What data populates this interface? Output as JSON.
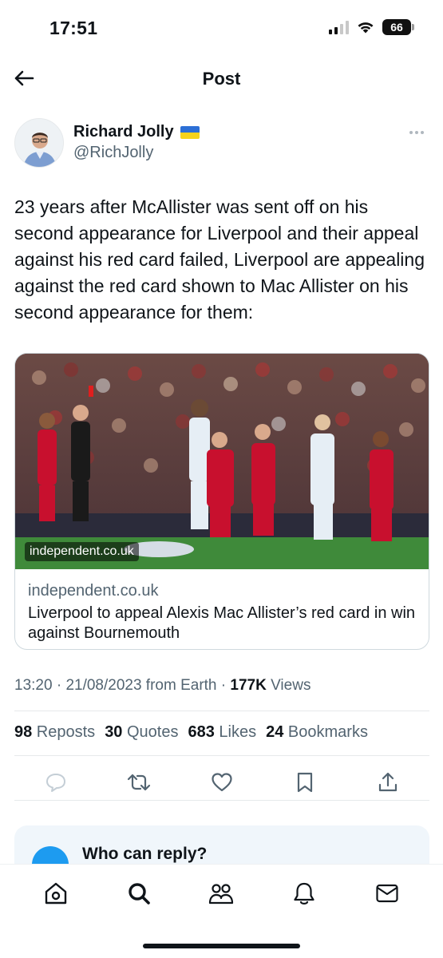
{
  "status_bar": {
    "time": "17:51",
    "battery": "66",
    "icons": [
      "signal-icon",
      "wifi-icon",
      "battery-icon"
    ]
  },
  "header": {
    "title": "Post",
    "back_icon": "arrow-left-icon"
  },
  "author": {
    "name": "Richard Jolly",
    "handle": "@RichJolly",
    "flag_icon": "ukraine-flag-icon",
    "more_icon": "more-dots-icon"
  },
  "post": {
    "text": "23 years after McAllister was sent off on his second appearance for Liverpool and their appeal against his red card failed, Liverpool are appealing against the red card shown to Mac Allister on his second appearance for them:"
  },
  "link_card": {
    "image_domain": "independent.co.uk",
    "domain": "independent.co.uk",
    "title": "Liverpool to appeal Alexis Mac Allister’s red card in win against Bournemouth"
  },
  "meta": {
    "time": "13:20",
    "separator1": " · ",
    "date": "21/08/2023",
    "source": " from Earth",
    "separator2": " · ",
    "views_count": "177K",
    "views_label": " Views"
  },
  "stats": [
    {
      "count": "98",
      "label": " Reposts"
    },
    {
      "count": "30",
      "label": " Quotes"
    },
    {
      "count": "683",
      "label": " Likes"
    },
    {
      "count": "24",
      "label": " Bookmarks"
    }
  ],
  "actions": [
    "reply-icon",
    "repost-icon",
    "like-icon",
    "bookmark-icon",
    "share-icon"
  ],
  "reply_settings": {
    "title": "Who can reply?"
  },
  "bottom_nav": [
    "home-icon",
    "search-icon",
    "communities-icon",
    "notifications-icon",
    "messages-icon"
  ],
  "colors": {
    "accent": "#1d9bf0",
    "text": "#0f1419",
    "secondary": "#536471",
    "divider": "#e6e9eb",
    "reply_box": "#f0f6fb"
  }
}
